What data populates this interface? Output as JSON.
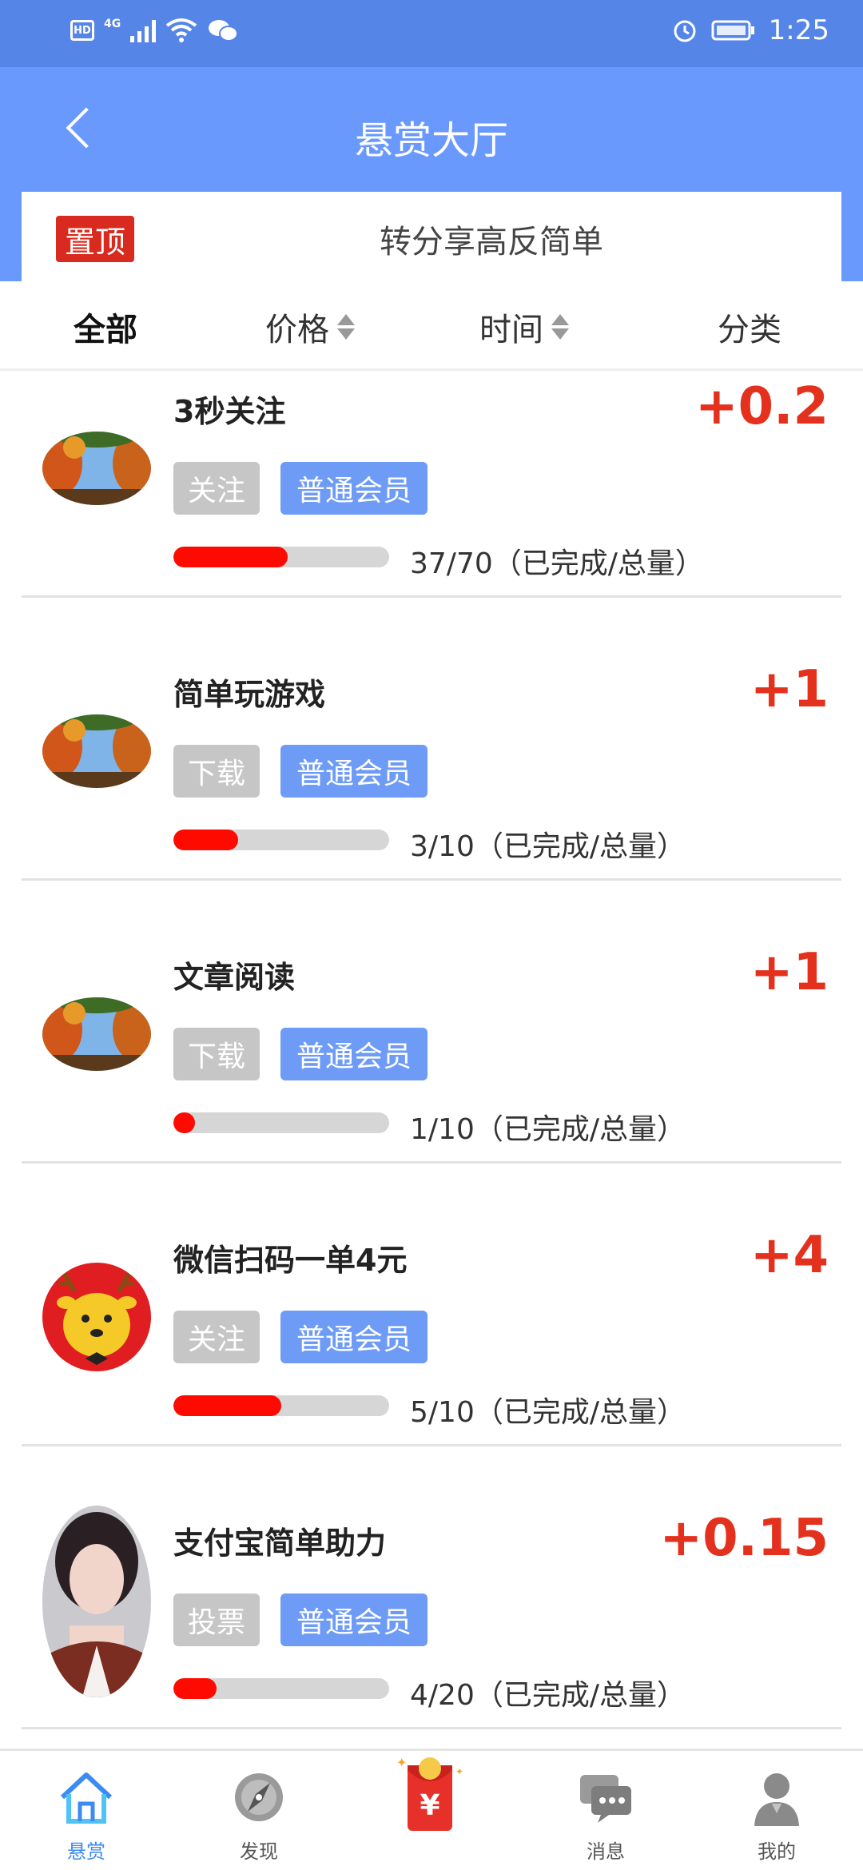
{
  "status_bar": {
    "hd": "HD",
    "network": "4G",
    "time": "1:25"
  },
  "header": {
    "title": "悬赏大厅"
  },
  "pinned": {
    "badge": "置顶",
    "text": "转分享高反简单"
  },
  "filters": [
    {
      "label": "全部",
      "active": true
    },
    {
      "label": "价格",
      "sortable": true
    },
    {
      "label": "时间",
      "sortable": true
    },
    {
      "label": "分类"
    }
  ],
  "tasks": [
    {
      "title": "3秒关注",
      "reward": "+0.2",
      "tag": "关注",
      "member": "普通会员",
      "progress_text": "37/70（已完成/总量）",
      "done": 37,
      "total": 70,
      "avatar": "autumn-landscape"
    },
    {
      "title": "简单玩游戏",
      "reward": "+1",
      "tag": "下载",
      "member": "普通会员",
      "progress_text": "3/10（已完成/总量）",
      "done": 3,
      "total": 10,
      "avatar": "autumn-landscape"
    },
    {
      "title": "文章阅读",
      "reward": "+1",
      "tag": "下载",
      "member": "普通会员",
      "progress_text": "1/10（已完成/总量）",
      "done": 1,
      "total": 10,
      "avatar": "autumn-landscape"
    },
    {
      "title": "微信扫码一单4元",
      "reward": "+4",
      "tag": "关注",
      "member": "普通会员",
      "progress_text": "5/10（已完成/总量）",
      "done": 5,
      "total": 10,
      "avatar": "cartoon-deer"
    },
    {
      "title": "支付宝简单助力",
      "reward": "+0.15",
      "tag": "投票",
      "member": "普通会员",
      "progress_text": "4/20（已完成/总量）",
      "done": 4,
      "total": 20,
      "avatar": "woman-portrait"
    }
  ],
  "nav": [
    {
      "label": "悬赏",
      "active": true,
      "icon": "home-icon"
    },
    {
      "label": "发现",
      "icon": "compass-icon"
    },
    {
      "label": "",
      "icon": "red-envelope-icon"
    },
    {
      "label": "消息",
      "icon": "chat-icon"
    },
    {
      "label": "我的",
      "icon": "person-icon"
    }
  ],
  "colors": {
    "header": "#6999FC",
    "status_bar": "#5685E8",
    "reward": "#E3311D",
    "progress": "#FF0A00",
    "member_tag": "#6D9BF6",
    "type_tag": "#C6C6C6",
    "nav_active": "#3C8BF2"
  }
}
